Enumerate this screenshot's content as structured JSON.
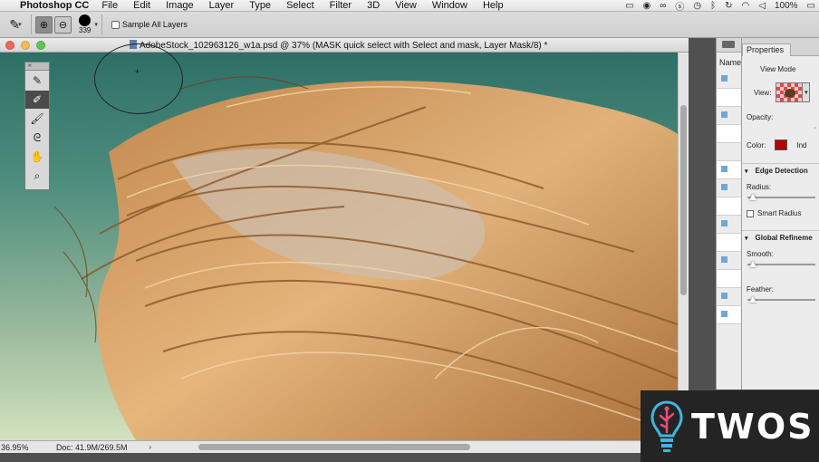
{
  "menubar": {
    "apple": "",
    "app_name": "Photoshop CC",
    "items": [
      "File",
      "Edit",
      "Image",
      "Layer",
      "Type",
      "Select",
      "Filter",
      "3D",
      "View",
      "Window",
      "Help"
    ],
    "status_icons": [
      "ps-status-icon",
      "audio-icon",
      "creative-cloud-icon",
      "skype-icon",
      "time-machine-icon",
      "bluetooth-icon",
      "sync-icon",
      "wifi-icon",
      "volume-icon"
    ],
    "battery": "100%"
  },
  "optionsbar": {
    "brush_size": "339",
    "sample_all_label": "Sample All Layers"
  },
  "document": {
    "title": "AdobeStock_102963126_w1a.psd @ 37% (MASK quick select with Select and mask, Layer Mask/8) *",
    "zoom": "36.95%",
    "doc_size": "Doc: 41.9M/269.5M",
    "status_arrow": "›"
  },
  "toolpalette": {
    "header": "«",
    "tools": [
      "quick-selection-tool",
      "refine-edge-brush-tool",
      "brush-tool",
      "lasso-tool",
      "hand-tool",
      "zoom-tool"
    ],
    "glyphs": [
      "✎",
      "✐",
      "🖌",
      "ᘓ",
      "✋",
      "⌕"
    ],
    "active_index": 1
  },
  "layers": {
    "label": "Name"
  },
  "properties": {
    "tab_label": "Properties",
    "view_mode_label": "View Mode",
    "view_label": "View:",
    "opacity_label": "Opacity:",
    "color_label": "Color:",
    "color_after": "Ind",
    "color_value": "#b60000",
    "edge_detection_label": "Edge Detection",
    "radius_label": "Radius:",
    "smart_radius_label": "Smart Radius",
    "global_refinements_label": "Global Refineme",
    "smooth_label": "Smooth:",
    "feather_label": "Feather:"
  },
  "watermark": {
    "text": "TWOS",
    "accent_color": "#3fb6e0"
  }
}
